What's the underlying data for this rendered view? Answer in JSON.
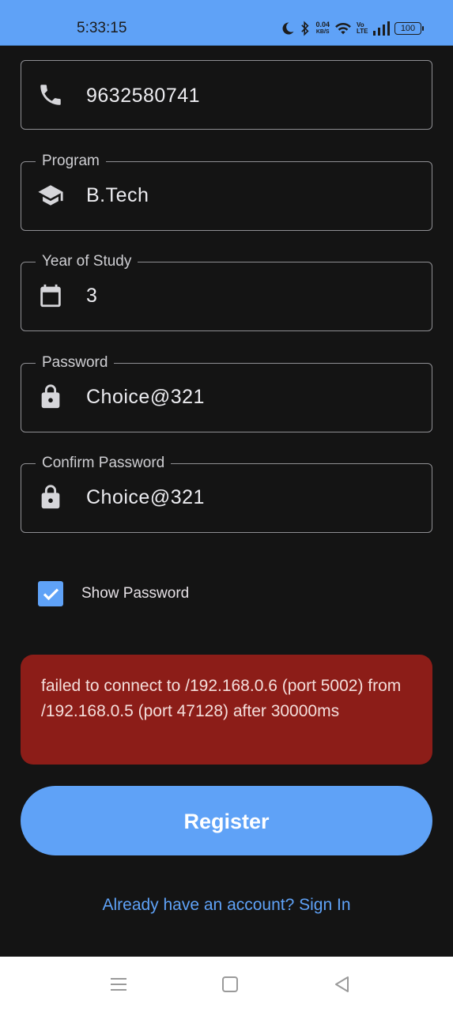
{
  "status_bar": {
    "time": "5:33:15",
    "net_speed_value": "0.04",
    "net_speed_unit": "KB/S",
    "volte": "Vo LTE",
    "battery": "100",
    "icons": [
      "moon-icon",
      "bluetooth-icon",
      "wifi-icon",
      "volte-icon",
      "signal-icon",
      "battery-icon"
    ]
  },
  "form": {
    "phone": {
      "label": "",
      "value": "9632580741",
      "icon": "phone-icon"
    },
    "program": {
      "label": "Program",
      "value": "B.Tech",
      "icon": "graduation-cap-icon"
    },
    "year": {
      "label": "Year of Study",
      "value": "3",
      "icon": "calendar-icon"
    },
    "password": {
      "label": "Password",
      "value": "Choice@321",
      "icon": "lock-icon"
    },
    "confirm_password": {
      "label": "Confirm Password",
      "value": "Choice@321",
      "icon": "lock-icon"
    },
    "show_password": {
      "label": "Show Password",
      "checked": true
    }
  },
  "error": {
    "message": "failed to connect to /192.168.0.6 (port 5002) from /192.168.0.5 (port 47128) after 30000ms"
  },
  "actions": {
    "register_label": "Register",
    "signin_label": "Already have an account? Sign In"
  },
  "nav": [
    "menu-icon",
    "home-square-icon",
    "back-triangle-icon"
  ],
  "colors": {
    "accent": "#5fa2f7",
    "background": "#141414",
    "error_bg": "#8c1d18"
  }
}
